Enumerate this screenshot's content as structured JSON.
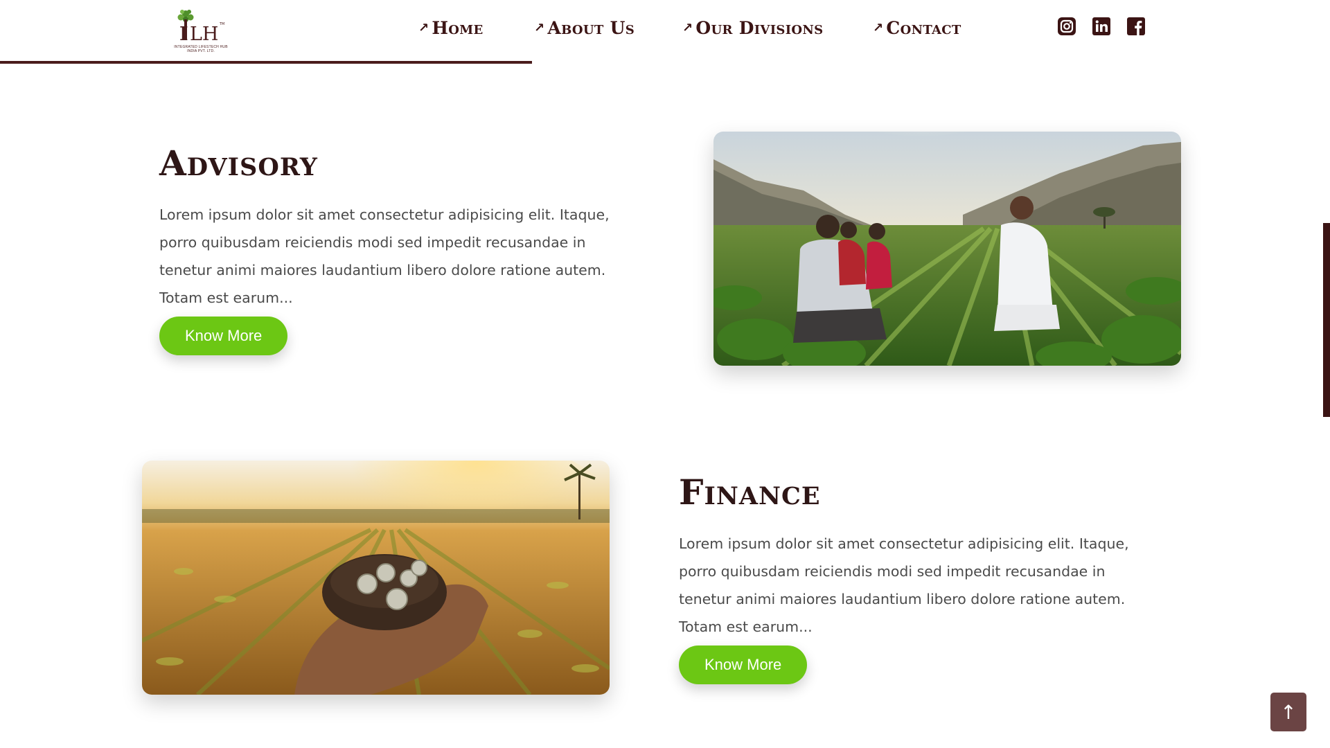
{
  "header": {
    "logo": {
      "icon": "tree-logo",
      "brand": "ILH",
      "tagline": "INTEGRATED LIFESTECH HUB INDIA PVT. LTD."
    },
    "nav": [
      {
        "label": "Home",
        "icon": "arrow-up-right-icon"
      },
      {
        "label": "About Us",
        "icon": "arrow-up-right-icon"
      },
      {
        "label": "Our Divisions",
        "icon": "arrow-up-right-icon"
      },
      {
        "label": "Contact",
        "icon": "arrow-up-right-icon"
      }
    ],
    "social": [
      {
        "name": "instagram",
        "icon": "instagram-icon"
      },
      {
        "name": "linkedin",
        "icon": "linkedin-icon"
      },
      {
        "name": "facebook",
        "icon": "facebook-icon"
      }
    ]
  },
  "sections": [
    {
      "title": "Advisory",
      "text": "Lorem ipsum dolor sit amet consectetur adipisicing elit. Itaque, porro quibusdam reiciendis modi sed impedit recusandae in tenetur animi maiores laudantium libero dolore ratione autem. Totam est earum...",
      "button": "Know More",
      "image": "farmers-in-field-photo"
    },
    {
      "title": "Finance",
      "text": "Lorem ipsum dolor sit amet consectetur adipisicing elit. Itaque, porro quibusdam reiciendis modi sed impedit recusandae in tenetur animi maiores laudantium libero dolore ratione autem. Totam est earum...",
      "button": "Know More",
      "image": "coins-in-soil-photo"
    }
  ],
  "scroll_top": {
    "label": "↑",
    "icon": "arrow-up-icon"
  },
  "colors": {
    "brand": "#3b1414",
    "accent": "#6cc714",
    "text": "#4a4a4a",
    "scroll_button": "#6b4444"
  }
}
